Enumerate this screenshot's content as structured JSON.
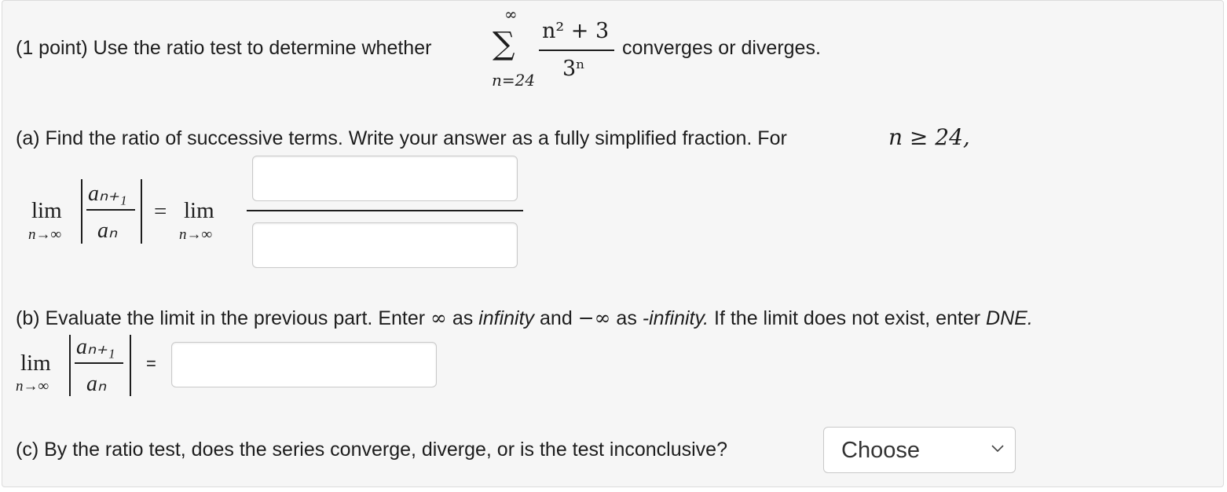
{
  "problem": {
    "intro": "(1 point) Use the ratio test to determine whether",
    "outro": "converges or diverges.",
    "series": {
      "sigma": "∑",
      "upper": "∞",
      "lower": "n=24",
      "numerator": "n² + 3",
      "denominator": "3ⁿ"
    }
  },
  "part_a": {
    "text": "(a) Find the ratio of successive terms. Write your answer as a fully simplified fraction. For",
    "condition": "n ≥ 24,",
    "lim": "lim",
    "sub": "n→∞",
    "term_num": "aₙ₊₁",
    "term_den": "aₙ",
    "equals": "=",
    "numerator_value": "",
    "denominator_value": ""
  },
  "part_b": {
    "prefix": "(b) Evaluate the limit in the previous part. Enter",
    "inf_symbol": "∞",
    "as1": "as",
    "infinity": "infinity",
    "and": "and",
    "neg_inf_symbol": "−∞",
    "as2": "as",
    "neg_infinity": "-infinity.",
    "mid": "If the limit does not exist, enter",
    "dne": "DNE.",
    "lim": "lim",
    "sub": "n→∞",
    "term_num": "aₙ₊₁",
    "term_den": "aₙ",
    "equals": "=",
    "answer_value": ""
  },
  "part_c": {
    "text": "(c) By the ratio test, does the series converge, diverge, or is the test inconclusive?",
    "select_value": "Choose"
  }
}
